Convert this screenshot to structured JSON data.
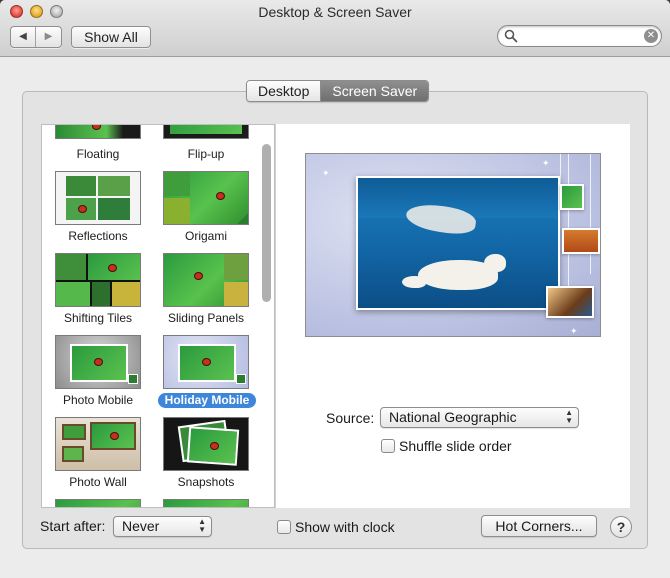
{
  "window": {
    "title": "Desktop & Screen Saver"
  },
  "toolbar": {
    "back_glyph": "◀",
    "forward_glyph": "▶",
    "show_all_label": "Show All",
    "search_value": ""
  },
  "tabs": [
    {
      "label": "Desktop",
      "selected": false
    },
    {
      "label": "Screen Saver",
      "selected": true
    }
  ],
  "modules": [
    {
      "label": "Floating"
    },
    {
      "label": "Flip-up"
    },
    {
      "label": "Reflections"
    },
    {
      "label": "Origami"
    },
    {
      "label": "Shifting Tiles"
    },
    {
      "label": "Sliding Panels"
    },
    {
      "label": "Photo Mobile"
    },
    {
      "label": "Holiday Mobile",
      "selected": true
    },
    {
      "label": "Photo Wall"
    },
    {
      "label": "Snapshots"
    }
  ],
  "source": {
    "label": "Source:",
    "value": "National Geographic"
  },
  "shuffle": {
    "label": "Shuffle slide order",
    "checked": false
  },
  "start_after": {
    "label": "Start after:",
    "value": "Never"
  },
  "show_clock": {
    "label": "Show with clock",
    "checked": false
  },
  "hot_corners_label": "Hot Corners...",
  "help_label": "?",
  "colors": {
    "selection": "#3d86d9",
    "tab_selected": "#7a7a7a"
  }
}
